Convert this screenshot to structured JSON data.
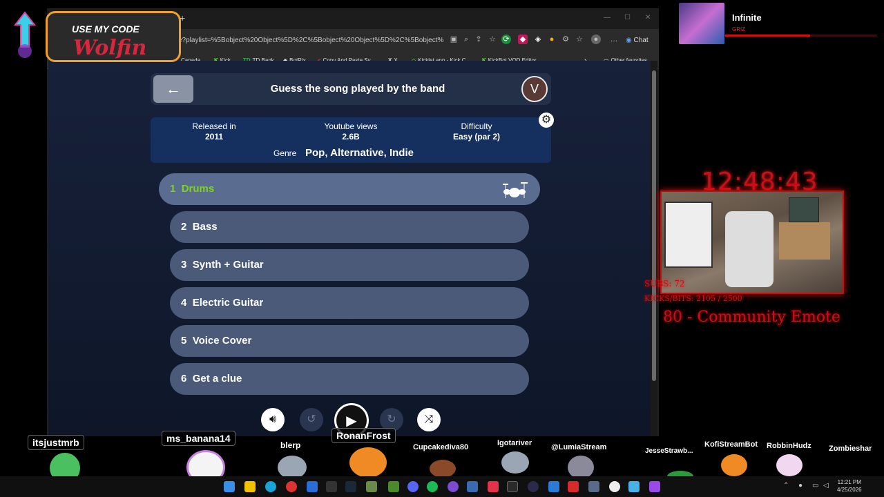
{
  "promo": {
    "line1": "USE MY CODE",
    "line2": "Wolfin"
  },
  "now_playing": {
    "title": "Infinite",
    "artist": "GRIZ",
    "progress": 0.56
  },
  "browser": {
    "url": "e?playlist=%5Bobject%20Object%5D%2C%5Bobject%20Object%5D%2C%5Bobject%20Obj...",
    "chat_label": "Chat",
    "favorites": [
      {
        "icon": "",
        "label": "Canada..."
      },
      {
        "icon": "K",
        "label": "Kick"
      },
      {
        "icon": "TD",
        "label": "TD Bank"
      },
      {
        "icon": "◆",
        "label": "BotRix"
      },
      {
        "icon": "<",
        "label": "Copy And Paste Sy..."
      },
      {
        "icon": "X",
        "label": "X"
      },
      {
        "icon": "◇",
        "label": "Kicklet.app - Kick C..."
      },
      {
        "icon": "K",
        "label": "KickBot VOD Editor"
      }
    ],
    "other_favorites": "Other favorites"
  },
  "game": {
    "title": "Guess the song played by the band",
    "avatar_letter": "V",
    "info": {
      "released_label": "Released in",
      "released_value": "2011",
      "views_label": "Youtube views",
      "views_value": "2.6B",
      "difficulty_label": "Difficulty",
      "difficulty_value": "Easy (par 2)",
      "genre_label": "Genre",
      "genre_value": "Pop, Alternative, Indie"
    },
    "rows": [
      {
        "num": "1",
        "label": "Drums",
        "active": true
      },
      {
        "num": "2",
        "label": "Bass",
        "active": false
      },
      {
        "num": "3",
        "label": "Synth + Guitar",
        "active": false
      },
      {
        "num": "4",
        "label": "Electric Guitar",
        "active": false
      },
      {
        "num": "5",
        "label": "Voice Cover",
        "active": false
      },
      {
        "num": "6",
        "label": "Get a clue",
        "active": false
      }
    ]
  },
  "stream": {
    "clock": "12:48:43",
    "subs": "SUBS: 72",
    "kicks": "KICKS/BITS: 2105 / 2500",
    "goal": "80 - Community Emote"
  },
  "viewers": [
    "itsjustmrb",
    "ms_banana14",
    "blerp",
    "RonanFrost",
    "Cupcakediva80",
    "Igotariver",
    "@LumiaStream",
    "JesseStrawb...",
    "KofiStreamBot",
    "RobbinHudz",
    "Zombieshar"
  ],
  "taskbar": {
    "time": "12:21 PM",
    "date": "4/25/2026"
  },
  "colors": {
    "active_row_text": "#7ed321",
    "accent_red": "#c8101a",
    "promo_border": "#f0a030"
  }
}
